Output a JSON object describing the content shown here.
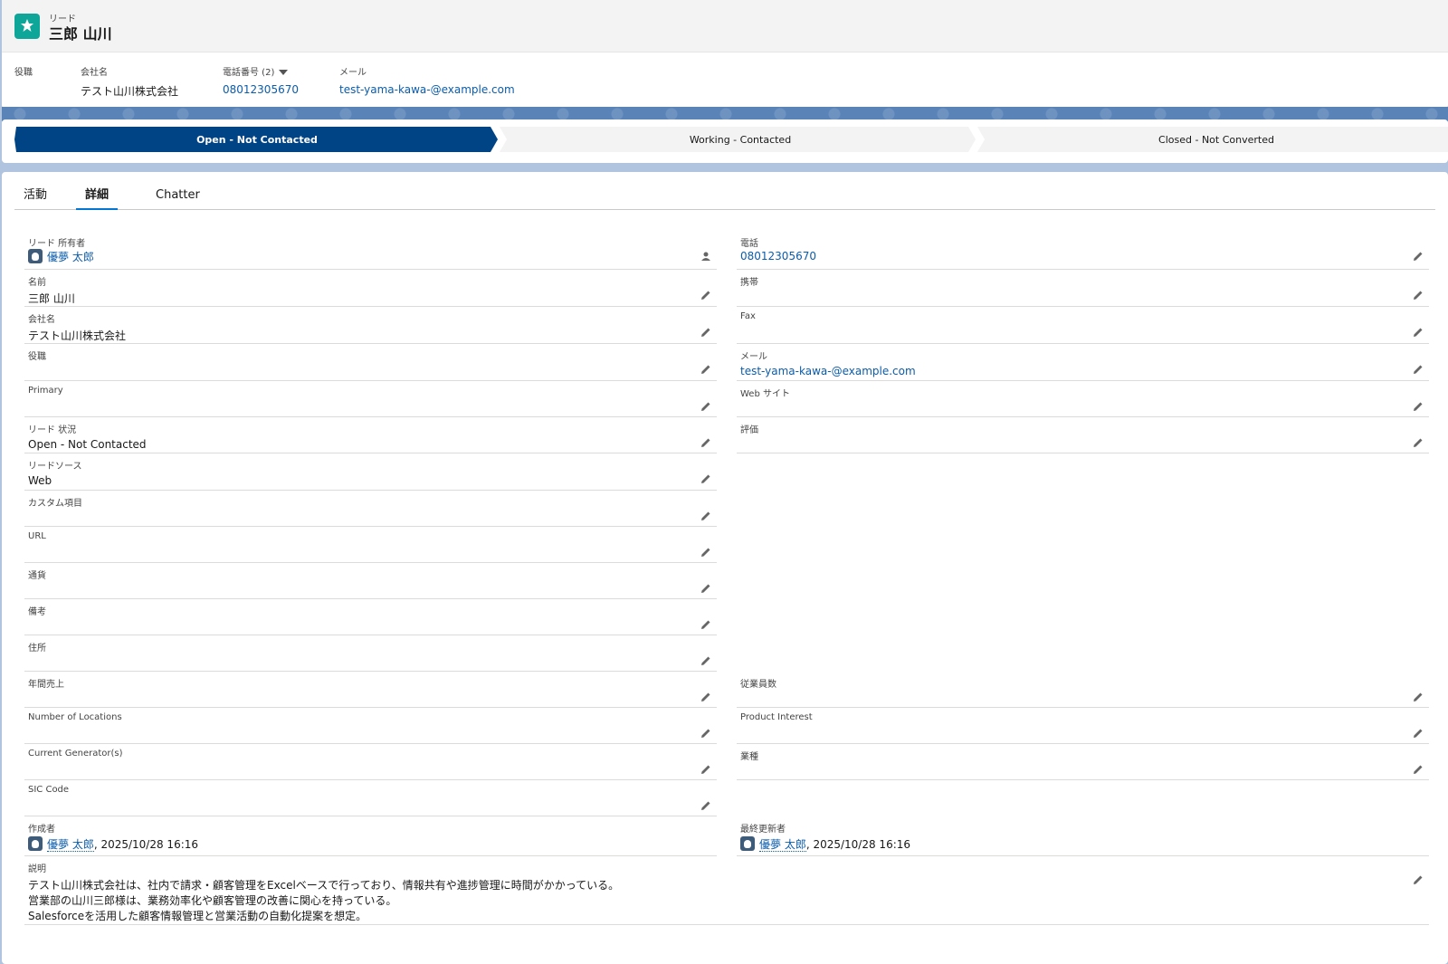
{
  "header": {
    "object_label": "リード",
    "record_name": "三郎 山川",
    "fields": [
      {
        "label": "役職",
        "value": ""
      },
      {
        "label": "会社名",
        "value": "テスト山川株式会社"
      },
      {
        "label": "電話番号 (2)",
        "value": "08012305670"
      },
      {
        "label": "メール",
        "value": "test-yama-kawa-@example.com"
      }
    ]
  },
  "path": {
    "stages": [
      {
        "label": "Open - Not Contacted",
        "active": true
      },
      {
        "label": "Working - Contacted",
        "active": false
      },
      {
        "label": "Closed - Not Converted",
        "active": false
      }
    ]
  },
  "tabs": [
    "活動",
    "詳細",
    "Chatter"
  ],
  "active_tab": "詳細",
  "details": {
    "owner": {
      "label": "リード 所有者",
      "value": "優夢 太郎"
    },
    "name": {
      "label": "名前",
      "value": "三郎 山川"
    },
    "company": {
      "label": "会社名",
      "value": "テスト山川株式会社"
    },
    "title": {
      "label": "役職",
      "value": ""
    },
    "primary": {
      "label": "Primary",
      "value": ""
    },
    "status": {
      "label": "リード 状況",
      "value": "Open - Not Contacted"
    },
    "source": {
      "label": "リードソース",
      "value": "Web"
    },
    "custom": {
      "label": "カスタム項目",
      "value": ""
    },
    "url": {
      "label": "URL",
      "value": ""
    },
    "currency": {
      "label": "通貨",
      "value": ""
    },
    "notes": {
      "label": "備考",
      "value": ""
    },
    "address": {
      "label": "住所",
      "value": ""
    },
    "revenue": {
      "label": "年間売上",
      "value": ""
    },
    "locations": {
      "label": "Number of Locations",
      "value": ""
    },
    "generators": {
      "label": "Current Generator(s)",
      "value": ""
    },
    "sic": {
      "label": "SIC Code",
      "value": ""
    },
    "phone": {
      "label": "電話",
      "value": "08012305670"
    },
    "mobile": {
      "label": "携帯",
      "value": ""
    },
    "fax": {
      "label": "Fax",
      "value": ""
    },
    "email": {
      "label": "メール",
      "value": "test-yama-kawa-@example.com"
    },
    "website": {
      "label": "Web サイト",
      "value": ""
    },
    "rating": {
      "label": "評価",
      "value": ""
    },
    "employees": {
      "label": "従業員数",
      "value": ""
    },
    "product_interest": {
      "label": "Product Interest",
      "value": ""
    },
    "industry": {
      "label": "業種",
      "value": ""
    },
    "created_by": {
      "label": "作成者",
      "user": "優夢 太郎",
      "date": ", 2025/10/28 16:16"
    },
    "modified_by": {
      "label": "最終更新者",
      "user": "優夢 太郎",
      "date": ", 2025/10/28 16:16"
    },
    "description": {
      "label": "説明",
      "lines": [
        "テスト山川株式会社は、社内で請求・顧客管理をExcelベースで行っており、情報共有や進捗管理に時間がかかっている。",
        "営業部の山川三郎様は、業務効率化や顧客管理の改善に関心を持っている。",
        "Salesforceを活用した顧客情報管理と営業活動の自動化提案を想定。"
      ]
    }
  },
  "colors": {
    "brand_icon": "#0fa69a",
    "active_stage": "#014486",
    "link": "#0b5cab",
    "active_tab_underline": "#0176d3"
  }
}
